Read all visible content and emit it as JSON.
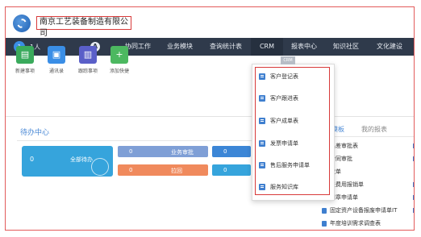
{
  "header": {
    "company_name": "南京工艺装备制造有限公司"
  },
  "navbar": {
    "user_count": "1人",
    "avatar_text": "1",
    "a_icon": "A",
    "items": [
      {
        "label": "协同工作"
      },
      {
        "label": "业务模块"
      },
      {
        "label": "查询统计表"
      },
      {
        "label": "CRM"
      },
      {
        "label": "报表中心"
      },
      {
        "label": "知识社区"
      },
      {
        "label": "文化建设"
      }
    ],
    "crm_tag": "CRM"
  },
  "quick_actions": [
    {
      "label": "新建事项",
      "icon": "new-item-icon",
      "color": "#3aaa5c"
    },
    {
      "label": "通讯录",
      "icon": "contacts-icon",
      "color": "#3a8ee6"
    },
    {
      "label": "跟踪事项",
      "icon": "track-icon",
      "color": "#5a5fc8"
    },
    {
      "label": "添加快捷",
      "icon": "plus-icon",
      "glyph": "+",
      "color": "#4cb860"
    }
  ],
  "todo": {
    "title": "待办中心",
    "all_count": "0",
    "all_label": "全部待办",
    "stats": [
      {
        "num": "0",
        "label": "业务审批",
        "color": "#7f9fd6"
      },
      {
        "num": "0",
        "label": "拉回",
        "color": "#f08a5d"
      },
      {
        "num": "0",
        "label": "",
        "color": "#3c86d6"
      },
      {
        "num": "0",
        "label": "",
        "color": "#36a4dc"
      }
    ]
  },
  "crm_menu": [
    {
      "label": "客户登记表"
    },
    {
      "label": "客户跟进表"
    },
    {
      "label": "客户成单表"
    },
    {
      "label": "发票申请单"
    },
    {
      "label": "售后服务申请单"
    },
    {
      "label": "服务知识库"
    }
  ],
  "templates": {
    "tab_active": "的模板",
    "tab_other": "我的报表",
    "items": [
      {
        "label": "出差审批表"
      },
      {
        "label": "合同审批"
      },
      {
        "label": "款单"
      },
      {
        "label": "差费用报销单"
      },
      {
        "label": "用章申请单"
      },
      {
        "label": "固定资产设备报废申请单IT"
      },
      {
        "label": "年度培训需求调查表"
      }
    ]
  },
  "colors": {
    "navbar_bg": "#2f3a4b",
    "accent_blue": "#4a89d6",
    "highlight_red": "#d83a3a"
  }
}
